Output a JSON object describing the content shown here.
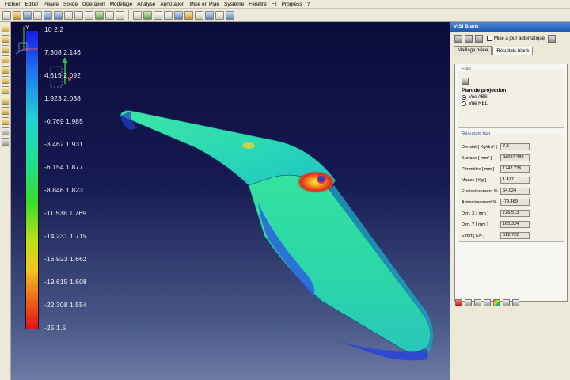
{
  "menubar": {
    "items": [
      "Fichier",
      "Editer",
      "Piliaire",
      "Solide",
      "Opération",
      "Modelage",
      "Analyse",
      "Annotation",
      "Mise en Plan",
      "Système",
      "Fenêtre",
      "Fil",
      "Progress",
      "?"
    ]
  },
  "legend": {
    "values": [
      "10  2.2",
      "7.308  2.146",
      "4.615  2.092",
      "1.923  2.038",
      "-0.769  1.985",
      "-3.462  1.931",
      "-6.154  1.877",
      "-8.846  1.823",
      "-11.538  1.769",
      "-14.231  1.715",
      "-16.923  1.662",
      "-19.615  1.608",
      "-22.308  1.554",
      "-25  1.5"
    ]
  },
  "triad": {
    "y_label": "Y"
  },
  "panel": {
    "title": "VISI Blank",
    "close_label": "×",
    "auto_update_label": "Mise à jour automatique",
    "tabs": [
      "Maillage pièce",
      "Résultats blank"
    ],
    "active_tab": "Résultats blank",
    "flan": {
      "group_title": "Flan",
      "projection_heading": "Plan de projection",
      "options": [
        "Vue ABS",
        "Vue REL"
      ],
      "selected": "Vue ABS"
    },
    "results": {
      "group_title": "Résultats flan",
      "rows": [
        {
          "label": "Densité [ Kg/dm³ ]",
          "value": "7.8"
        },
        {
          "label": "Surface [ mm² ]",
          "value": "94691.389"
        },
        {
          "label": "Périmètre [ mm ]",
          "value": "1742.735"
        },
        {
          "label": "Masse [ Kg ]",
          "value": "1.477"
        },
        {
          "label": "Epaississement %",
          "value": "64.024"
        },
        {
          "label": "Amincissement %",
          "value": "-79.489"
        },
        {
          "label": "Dim. X [ mm ]",
          "value": "726.513"
        },
        {
          "label": "Dim. Y [ mm ]",
          "value": "165.324"
        },
        {
          "label": "Effort [ KN ]",
          "value": "512.722"
        }
      ]
    }
  },
  "colors": {
    "legend_top": "#1a1ae8",
    "legend_bottom": "#e31313",
    "part_main": "#2ee08c",
    "title_bar": "#1f5bb5"
  }
}
